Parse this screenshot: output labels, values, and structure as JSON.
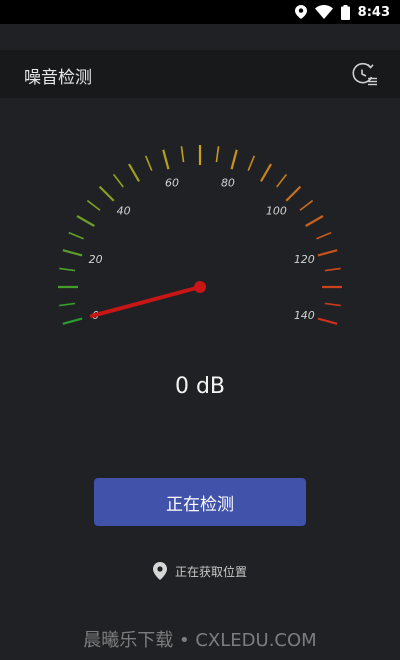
{
  "status_bar": {
    "time": "8:43",
    "icons": [
      "location-icon",
      "wifi-icon",
      "battery-icon"
    ]
  },
  "toolbar": {
    "title": "噪音检测",
    "history_icon": "history-icon"
  },
  "gauge": {
    "labels": [
      "0",
      "20",
      "40",
      "60",
      "80",
      "100",
      "120",
      "140"
    ],
    "current_value": 0,
    "colors": {
      "low": "#2e9b2e",
      "mid": "#c9a21a",
      "high": "#c8321e",
      "needle": "#c81616"
    }
  },
  "reading": {
    "text": "0 dB"
  },
  "actions": {
    "measure_label": "正在检测"
  },
  "location": {
    "text": "正在获取位置",
    "icon": "location-pin-icon"
  },
  "watermark": {
    "text": "晨曦乐下载 • CXLEDU.COM"
  }
}
